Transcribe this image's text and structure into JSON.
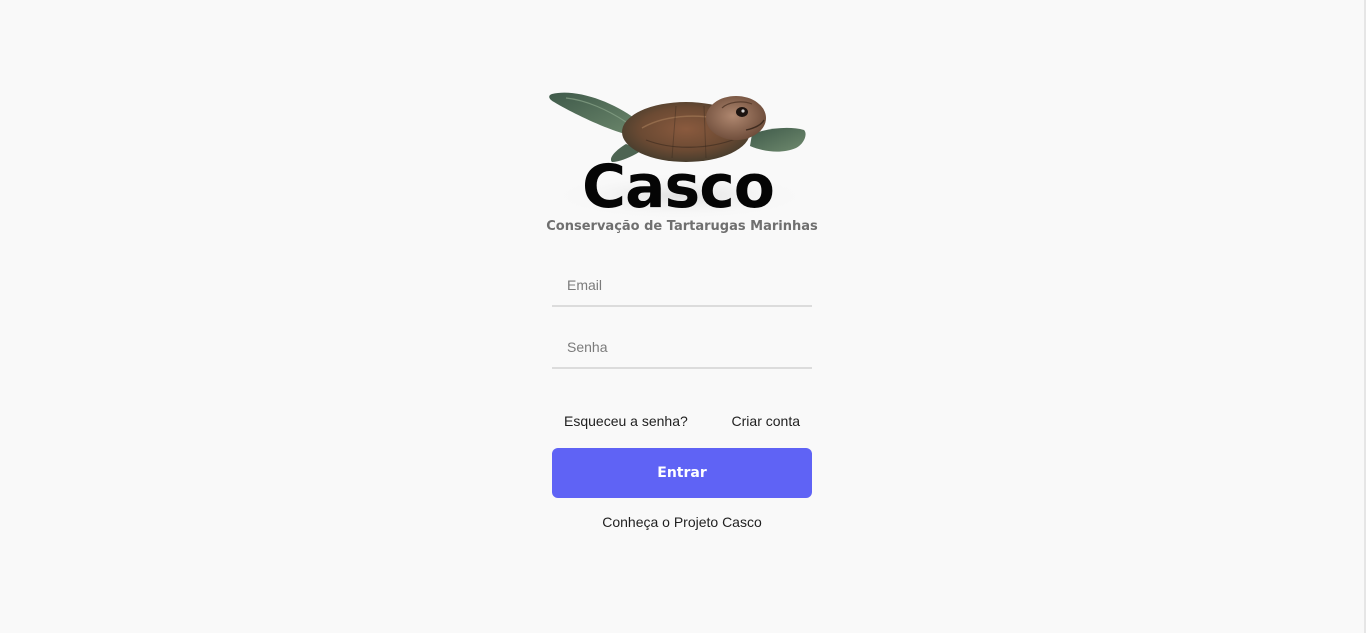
{
  "brand": {
    "name": "Casco",
    "tagline": "Conservação de Tartarugas Marinhas",
    "logo_icon": "sea-turtle-icon"
  },
  "form": {
    "email_placeholder": "Email",
    "password_placeholder": "Senha",
    "forgot_password": "Esqueceu a senha?",
    "create_account": "Criar conta",
    "submit_label": "Entrar"
  },
  "footer": {
    "project_link": "Conheça o Projeto Casco"
  },
  "colors": {
    "background": "#f9f9f9",
    "accent": "#5f63f5",
    "text": "#1f1f1f",
    "muted": "#6f6f6f"
  }
}
